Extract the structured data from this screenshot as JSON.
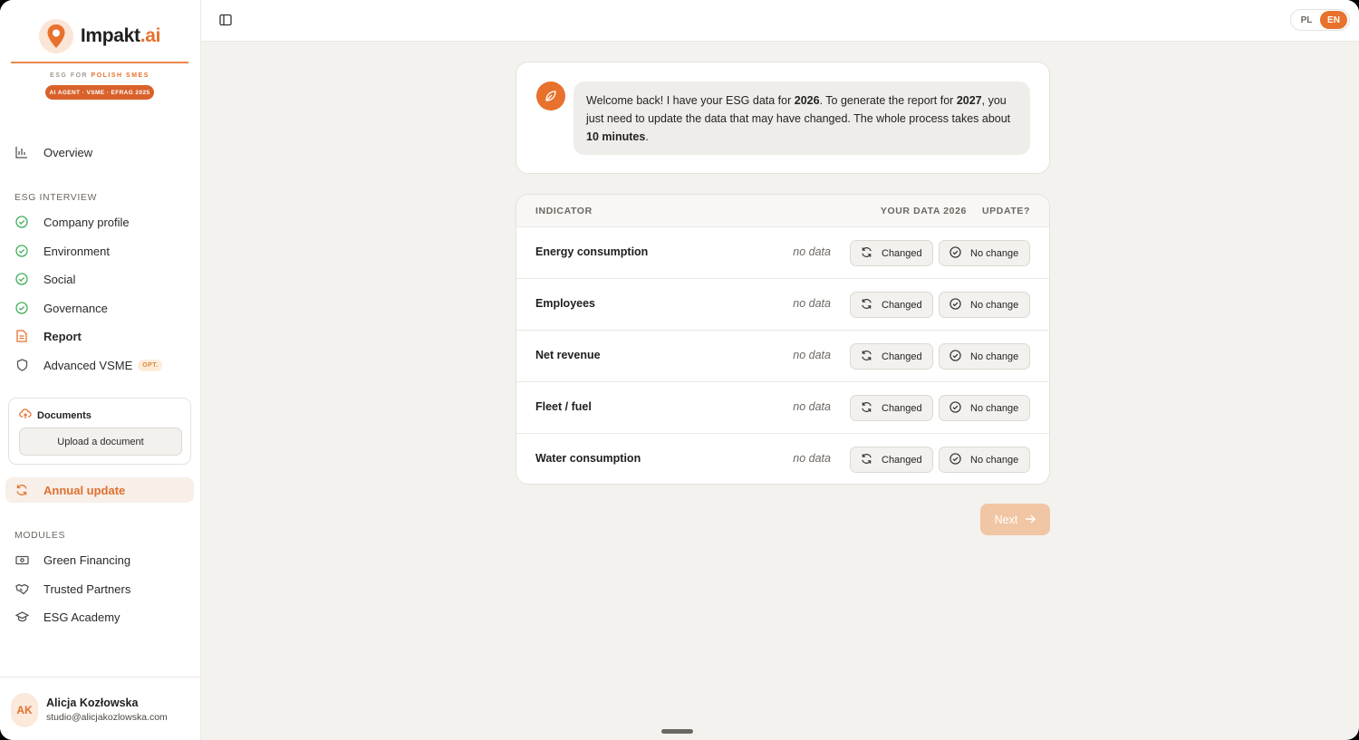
{
  "brand": {
    "name_main": "Impakt",
    "name_accent": ".ai",
    "tagline_prefix": "ESG FOR ",
    "tagline_highlight": "POLISH SMES",
    "badge": "AI AGENT · VSME · EFRAG 2025"
  },
  "sidebar": {
    "overview": "Overview",
    "interview_label": "ESG INTERVIEW",
    "interview_items": [
      {
        "label": "Company profile",
        "icon": "check-circle-icon"
      },
      {
        "label": "Environment",
        "icon": "check-circle-icon"
      },
      {
        "label": "Social",
        "icon": "check-circle-icon"
      },
      {
        "label": "Governance",
        "icon": "check-circle-icon"
      },
      {
        "label": "Report",
        "icon": "document-icon"
      },
      {
        "label": "Advanced VSME",
        "icon": "shield-icon",
        "badge": "OPT."
      }
    ],
    "documents": {
      "title": "Documents",
      "upload_label": "Upload a document"
    },
    "annual_update": "Annual update",
    "modules_label": "MODULES",
    "modules": [
      {
        "label": "Green Financing",
        "icon": "banknote-icon"
      },
      {
        "label": "Trusted Partners",
        "icon": "handshake-icon"
      },
      {
        "label": "ESG Academy",
        "icon": "graduation-cap-icon"
      }
    ],
    "user": {
      "initials": "AK",
      "name": "Alicja Kozłowska",
      "email": "studio@alicjakozlowska.com"
    }
  },
  "topbar": {
    "lang_pl": "PL",
    "lang_en": "EN",
    "active_lang": "EN"
  },
  "chat": {
    "p1": "Welcome back! I have your ESG data for ",
    "b1": "2026",
    "p2": ". To generate the report for ",
    "b2": "2027",
    "p3": ", you just need to update the data that may have changed. The whole process takes about ",
    "b3": "10 minutes",
    "p4": "."
  },
  "table": {
    "col_indicator": "INDICATOR",
    "col_data": "YOUR DATA 2026",
    "col_update": "UPDATE?",
    "changed_label": "Changed",
    "nochange_label": "No change",
    "rows": [
      {
        "name": "Energy consumption",
        "value": "no data"
      },
      {
        "name": "Employees",
        "value": "no data"
      },
      {
        "name": "Net revenue",
        "value": "no data"
      },
      {
        "name": "Fleet / fuel",
        "value": "no data"
      },
      {
        "name": "Water consumption",
        "value": "no data"
      }
    ]
  },
  "next_label": "Next",
  "colors": {
    "accent": "#e8712d",
    "success": "#3fae5a"
  }
}
